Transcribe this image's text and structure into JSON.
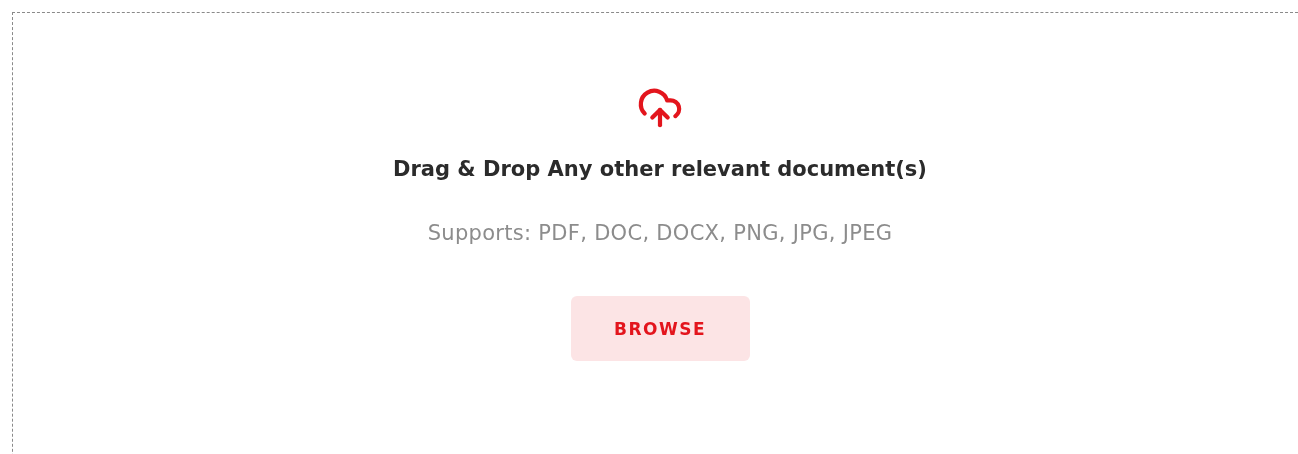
{
  "dropzone": {
    "title": "Drag & Drop Any other relevant document(s)",
    "hint": "Supports: PDF, DOC, DOCX, PNG, JPG, JPEG",
    "button": "BROWSE"
  }
}
